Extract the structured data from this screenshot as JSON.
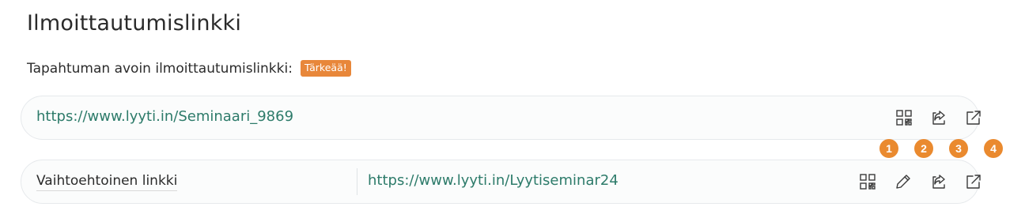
{
  "page": {
    "title": "Ilmoittautumislinkki",
    "subtitle": "Tapahtuman avoin ilmoittautumislinkki:",
    "badge": "Tärkeää!"
  },
  "primary_link": {
    "url": "https://www.lyyti.in/Seminaari_9869",
    "icons": [
      "qr-code-icon",
      "share-icon",
      "external-link-icon"
    ]
  },
  "alternative_link": {
    "label": "Vaihtoehtoinen linkki",
    "url": "https://www.lyyti.in/Lyytiseminar24",
    "icons": [
      "qr-code-icon",
      "edit-pencil-icon",
      "share-icon",
      "external-link-icon"
    ]
  },
  "markers": [
    "1",
    "2",
    "3",
    "4"
  ],
  "colors": {
    "link": "#2d7b6a",
    "badge": "#e8873a",
    "marker": "#ea8a2f"
  }
}
